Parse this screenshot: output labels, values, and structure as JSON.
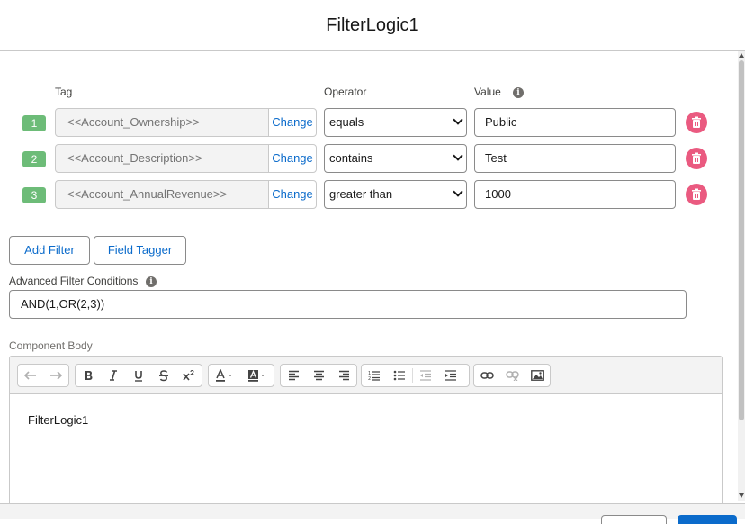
{
  "modal": {
    "title": "FilterLogic1"
  },
  "columns": {
    "tag": "Tag",
    "operator": "Operator",
    "value": "Value",
    "info_glyph": "i"
  },
  "filters": [
    {
      "num": "1",
      "tag": "<<Account_Ownership>>",
      "change": "Change",
      "operator": "equals",
      "value": "Public"
    },
    {
      "num": "2",
      "tag": "<<Account_Description>>",
      "change": "Change",
      "operator": "contains",
      "value": "Test"
    },
    {
      "num": "3",
      "tag": "<<Account_AnnualRevenue>>",
      "change": "Change",
      "operator": "greater than",
      "value": "1000"
    }
  ],
  "buttons": {
    "add_filter": "Add Filter",
    "field_tagger": "Field Tagger"
  },
  "advanced": {
    "label": "Advanced Filter Conditions",
    "value": "AND(1,OR(2,3))"
  },
  "editor": {
    "label": "Component Body",
    "content": "FilterLogic1",
    "toolbar": [
      "undo-icon",
      "redo-icon",
      "bold-icon",
      "italic-icon",
      "underline-icon",
      "strikethrough-icon",
      "superscript-icon",
      "text-color-icon",
      "background-color-icon",
      "align-left-icon",
      "align-center-icon",
      "align-right-icon",
      "numbered-list-icon",
      "bulleted-list-icon",
      "outdent-icon",
      "indent-icon",
      "link-icon",
      "unlink-icon",
      "image-icon"
    ]
  },
  "colors": {
    "accent": "#0b6bcb",
    "badge": "#6dbc78",
    "delete": "#ea5a80"
  }
}
